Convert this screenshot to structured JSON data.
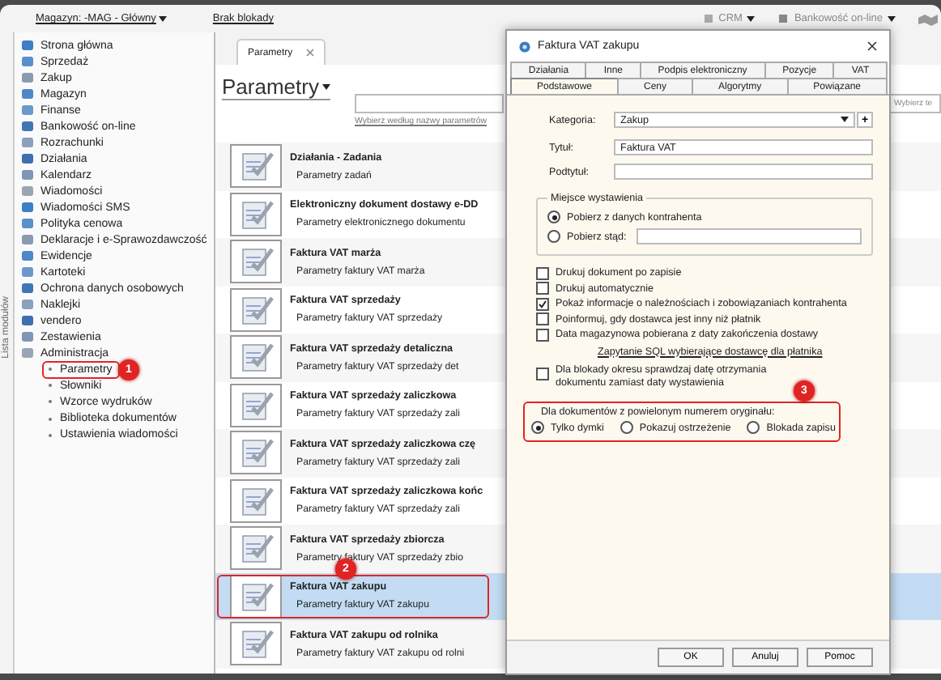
{
  "toolbar": {
    "warehouse": "Magazyn: -MAG - Główny",
    "lock_status": "Brak blokady",
    "crm": "CRM",
    "banking": "Bankowość on-line"
  },
  "side_tab": "Lista modułów",
  "sidebar": {
    "items": [
      {
        "label": "Strona główna"
      },
      {
        "label": "Sprzedaż"
      },
      {
        "label": "Zakup"
      },
      {
        "label": "Magazyn"
      },
      {
        "label": "Finanse"
      },
      {
        "label": "Bankowość on-line"
      },
      {
        "label": "Rozrachunki"
      },
      {
        "label": "Działania"
      },
      {
        "label": "Kalendarz"
      },
      {
        "label": "Wiadomości"
      },
      {
        "label": "Wiadomości SMS"
      },
      {
        "label": "Polityka cenowa"
      },
      {
        "label": "Deklaracje i e-Sprawozdawczość"
      },
      {
        "label": "Ewidencje"
      },
      {
        "label": "Kartoteki"
      },
      {
        "label": "Ochrona danych osobowych"
      },
      {
        "label": "Naklejki"
      },
      {
        "label": "vendero"
      },
      {
        "label": "Zestawienia"
      },
      {
        "label": "Administracja",
        "children": [
          {
            "label": "Parametry",
            "annotation": "1"
          },
          {
            "label": "Słowniki"
          },
          {
            "label": "Wzorce wydruków"
          },
          {
            "label": "Biblioteka dokumentów"
          },
          {
            "label": "Ustawienia wiadomości"
          }
        ]
      }
    ]
  },
  "tab": {
    "label": "Parametry"
  },
  "heading": "Parametry",
  "search": {
    "hint": "Wybierz według nazwy parametrów"
  },
  "right_search": {
    "placeholder": "Wybierz te"
  },
  "rows": [
    {
      "title": "Działania - Zadania",
      "subtitle": "Parametry zadań",
      "selected": false
    },
    {
      "title": "Elektroniczny dokument dostawy e-DD",
      "subtitle": "Parametry elektronicznego dokumentu",
      "selected": false
    },
    {
      "title": "Faktura VAT marża",
      "subtitle": "Parametry faktury VAT marża",
      "selected": false
    },
    {
      "title": "Faktura VAT sprzedaży",
      "subtitle": "Parametry faktury VAT sprzedaży",
      "selected": false
    },
    {
      "title": "Faktura VAT sprzedaży detaliczna",
      "subtitle": "Parametry faktury VAT sprzedaży det",
      "selected": false
    },
    {
      "title": "Faktura VAT sprzedaży zaliczkowa",
      "subtitle": "Parametry faktury VAT sprzedaży zali",
      "selected": false
    },
    {
      "title": "Faktura VAT sprzedaży zaliczkowa czę",
      "subtitle": "Parametry faktury VAT sprzedaży zali",
      "selected": false
    },
    {
      "title": "Faktura VAT sprzedaży zaliczkowa końc",
      "subtitle": "Parametry faktury VAT sprzedaży zali",
      "selected": false
    },
    {
      "title": "Faktura VAT sprzedaży zbiorcza",
      "subtitle": "Parametry faktury VAT sprzedaży zbio",
      "selected": false
    },
    {
      "title": "Faktura VAT zakupu",
      "subtitle": "Parametry faktury VAT zakupu",
      "selected": true,
      "annotation": "2"
    },
    {
      "title": "Faktura VAT zakupu od rolnika",
      "subtitle": "Parametry faktury VAT zakupu od rolni",
      "selected": false
    }
  ],
  "dialog": {
    "title": "Faktura VAT zakupu",
    "tab_rows": [
      [
        {
          "label": "Działania",
          "selected": false
        },
        {
          "label": "Inne",
          "selected": false
        },
        {
          "label": "Podpis elektroniczny",
          "selected": false
        },
        {
          "label": "Pozycje",
          "selected": false
        },
        {
          "label": "VAT",
          "selected": false
        }
      ],
      [
        {
          "label": "Podstawowe",
          "selected": true
        },
        {
          "label": "Ceny",
          "selected": false
        },
        {
          "label": "Algorytmy",
          "selected": false
        },
        {
          "label": "Powiązane",
          "selected": false
        }
      ]
    ],
    "category": {
      "label": "Kategoria:",
      "value": "Zakup",
      "add": "+"
    },
    "title_field": {
      "label": "Tytuł:",
      "value": "Faktura VAT"
    },
    "subtitle_field": {
      "label": "Podtytuł:"
    },
    "place": {
      "legend": "Miejsce wystawienia",
      "options": [
        {
          "kind": "radio",
          "label": "Pobierz z danych kontrahenta",
          "selected": true
        },
        {
          "kind": "radio_field",
          "label": "Pobierz stąd:",
          "selected": false
        }
      ]
    },
    "options": [
      {
        "kind": "checkbox",
        "label": "Drukuj dokument po zapisie",
        "checked": false
      },
      {
        "kind": "checkbox",
        "label": "Drukuj automatycznie",
        "checked": false
      },
      {
        "kind": "checkbox",
        "label": "Pokaż informacje o należnościach i zobowiązaniach kontrahenta",
        "checked": true
      },
      {
        "kind": "checkbox",
        "label": "Poinformuj, gdy dostawca jest inny niż płatnik",
        "checked": false
      },
      {
        "kind": "checkbox",
        "label": "Data magazynowa pobierana z daty zakończenia dostawy",
        "checked": false
      },
      {
        "kind": "link",
        "label": "Zapytanie SQL wybierające dostawcę dla płatnika"
      },
      {
        "kind": "checkbox",
        "label": "Dla blokady okresu sprawdzaj datę otrzymania dokumentu zamiast daty wystawienia",
        "checked": false
      }
    ],
    "duplicate": {
      "label": "Dla dokumentów z powielonym numerem oryginału:",
      "annotation": "3",
      "options": [
        {
          "label": "Tylko dymki",
          "selected": true
        },
        {
          "label": "Pokazuj ostrzeżenie",
          "selected": false
        },
        {
          "label": "Blokada zapisu",
          "selected": false
        }
      ]
    },
    "buttons": [
      "OK",
      "Anuluj",
      "Pomoc"
    ]
  }
}
